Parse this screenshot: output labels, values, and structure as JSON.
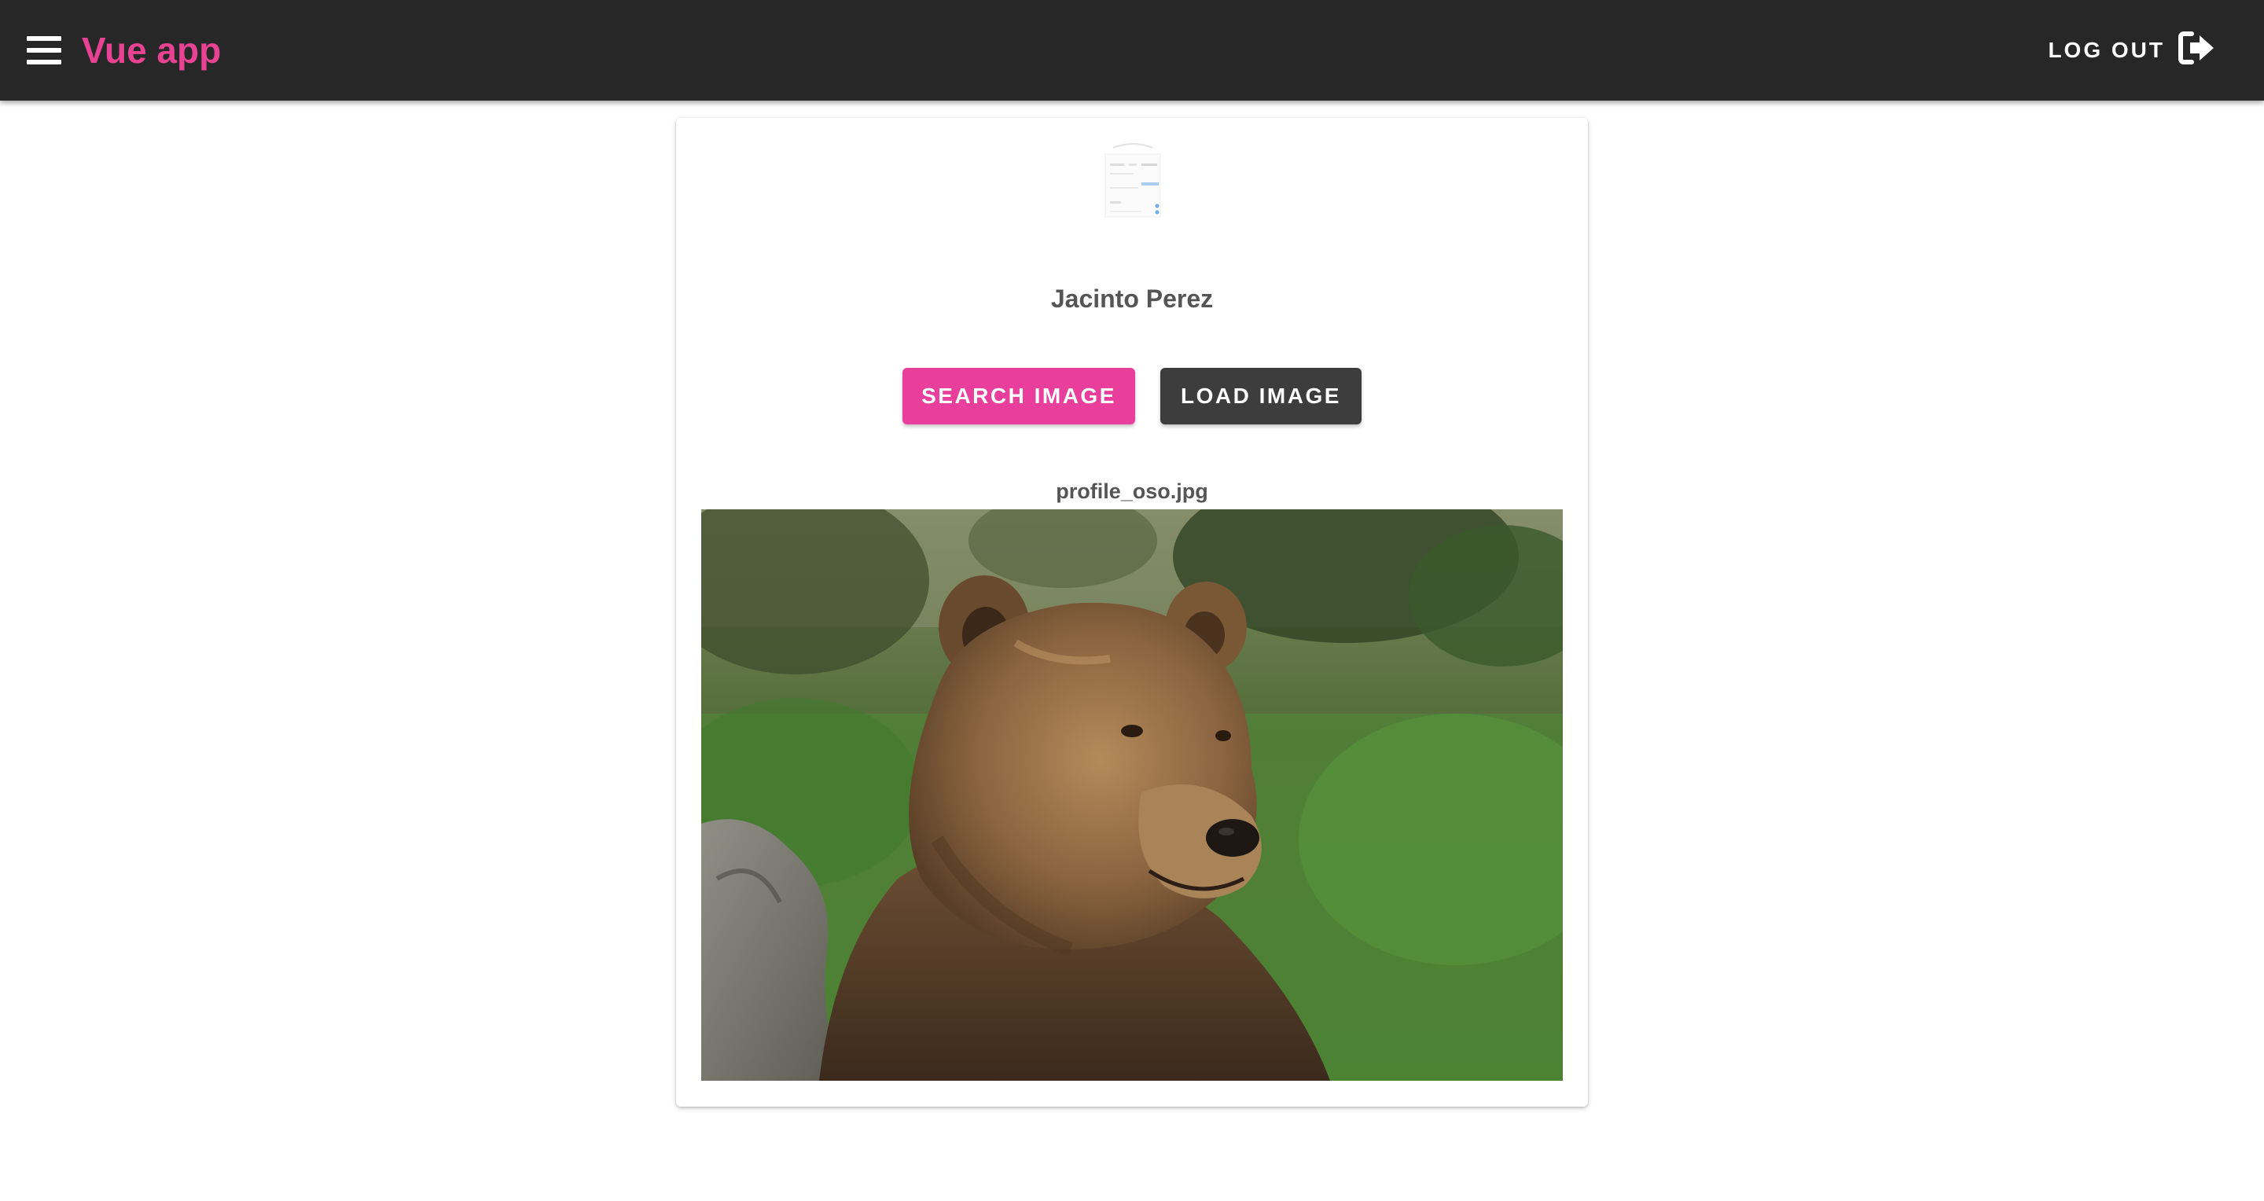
{
  "header": {
    "app_title": "Vue app",
    "logout_label": "LOG OUT",
    "menu_icon": "hamburger-menu-icon",
    "logout_icon": "logout-arrow-icon",
    "background_color": "#272727",
    "accent_color": "#e84393"
  },
  "profile": {
    "name": "Jacinto Perez",
    "search_button_label": "SEARCH IMAGE",
    "load_button_label": "LOAD IMAGE",
    "file_name": "profile_oso.jpg",
    "search_button_color": "#ea3e9d",
    "load_button_color": "#3d3d3d"
  }
}
